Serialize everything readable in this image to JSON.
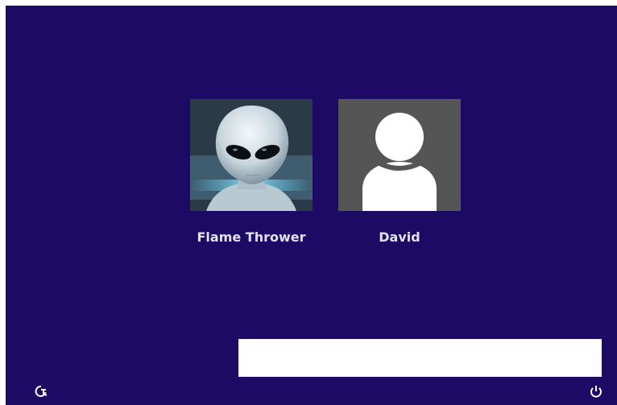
{
  "login_screen": {
    "users": [
      {
        "name": "Flame Thrower",
        "avatar": "alien-avatar"
      },
      {
        "name": "David",
        "avatar": "default-user-avatar"
      }
    ],
    "background_color": "#1c0a64",
    "icons": {
      "bottom_left": "ease-of-access-icon",
      "bottom_right": "power-icon"
    }
  }
}
